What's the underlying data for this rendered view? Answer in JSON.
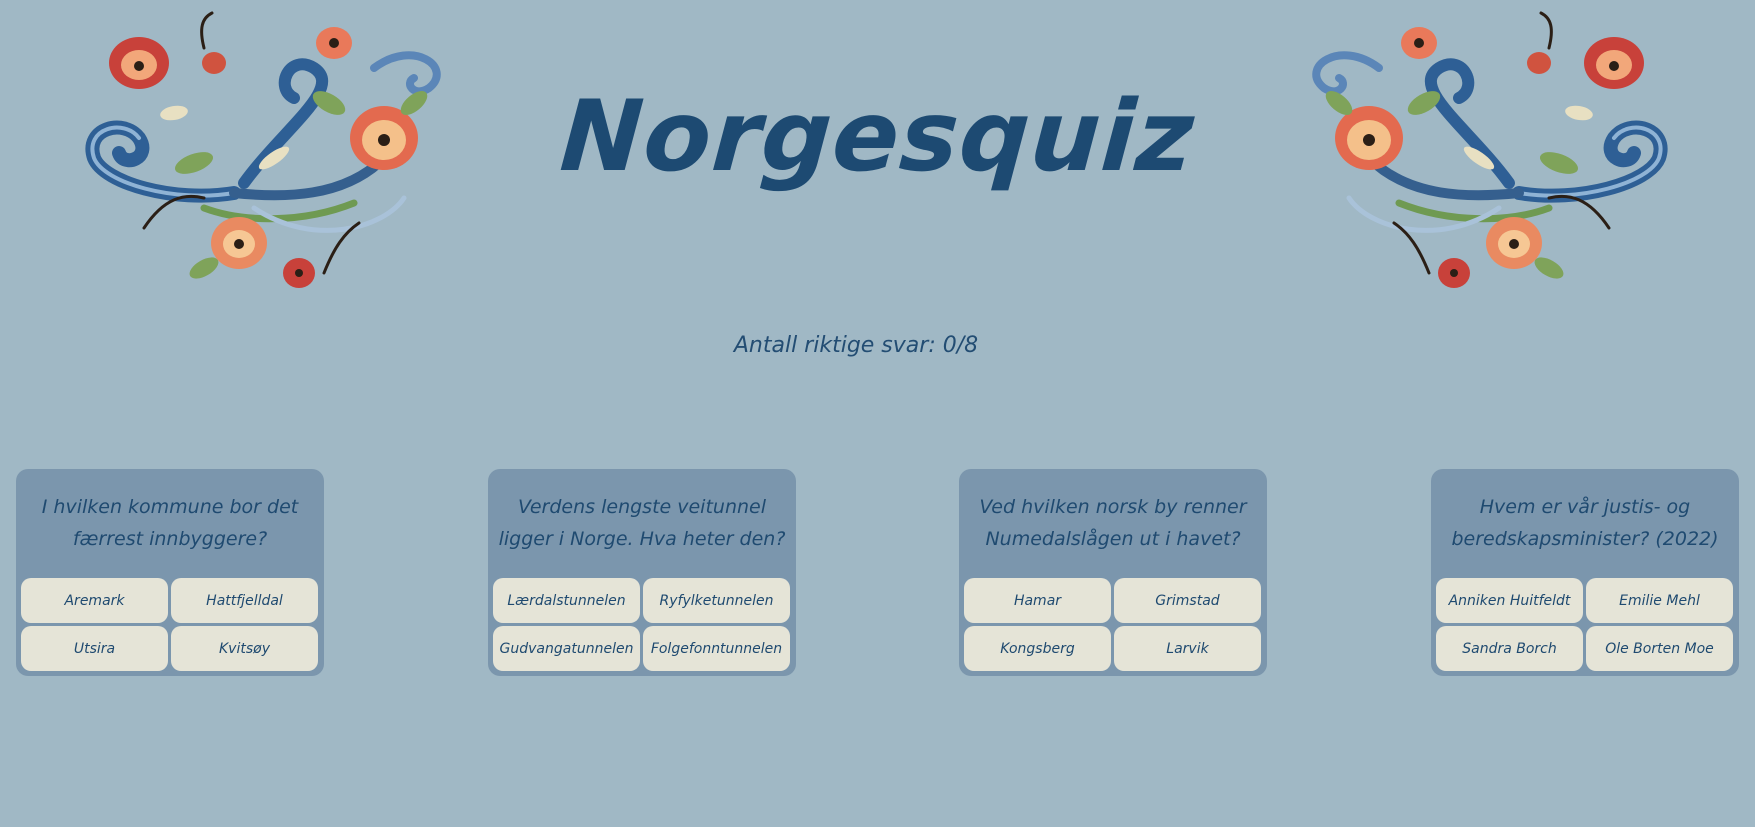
{
  "header": {
    "title": "Norgesquiz",
    "left_ornament_icon": "rosemaling-flower-ornament-icon",
    "right_ornament_icon": "rosemaling-flower-ornament-icon"
  },
  "score": {
    "text": "Antall riktige svar: 0/8"
  },
  "colors": {
    "background": "#a0b8c5",
    "card": "#7b96ad",
    "answer_button": "#e5e4d7",
    "text": "#1f4a70"
  },
  "questions": [
    {
      "question": "I hvilken kommune bor det færrest innbyggere?",
      "answers": [
        "Aremark",
        "Hattfjelldal",
        "Utsira",
        "Kvitsøy"
      ]
    },
    {
      "question": "Verdens lengste veitunnel ligger i Norge. Hva heter den?",
      "answers": [
        "Lærdalstunnelen",
        "Ryfylketunnelen",
        "Gudvangatunnelen",
        "Folgefonntunnelen"
      ]
    },
    {
      "question": "Ved hvilken norsk by renner Numedalslågen ut i havet?",
      "answers": [
        "Hamar",
        "Grimstad",
        "Kongsberg",
        "Larvik"
      ]
    },
    {
      "question": "Hvem er vår justis- og beredskapsminister? (2022)",
      "answers": [
        "Anniken Huitfeldt",
        "Emilie Mehl",
        "Sandra Borch",
        "Ole Borten Moe"
      ]
    }
  ]
}
